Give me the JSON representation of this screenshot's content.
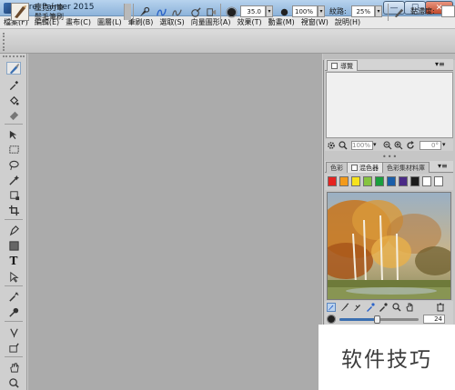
{
  "window": {
    "title": "Corel Painter 2015",
    "min_glyph": "—",
    "max_glyph": "☐",
    "close_glyph": "✕"
  },
  "menu": [
    "檔案(F)",
    "編輯(E)",
    "畫布(C)",
    "圖層(L)",
    "筆刷(B)",
    "選取(S)",
    "向量圖形(A)",
    "效果(T)",
    "動畫(M)",
    "視窗(W)",
    "說明(H)"
  ],
  "property_bar": {
    "brush_category": "壓克力筆",
    "brush_variant": "鬃毛筆刷",
    "size_value": "35.0",
    "opacity_value": "100%",
    "grain_label": "紋路:",
    "grain_value": "25%",
    "viscosity_label": "黏滯度:"
  },
  "navigator": {
    "tab_label": "導覽",
    "zoom_value": "100%",
    "rotate_value": "0°"
  },
  "color_panel": {
    "tabs": [
      "色彩",
      "混色器",
      "色彩集材料庫"
    ],
    "swatches": [
      "#e52421",
      "#f39a1b",
      "#f6e21c",
      "#86c440",
      "#1a9e3e",
      "#1b5fa9",
      "#4a2a86",
      "#1c1c1c",
      "#ffffff",
      "#ffffff"
    ],
    "brush_size_value": "24"
  },
  "watermark": "软件技巧",
  "colors": {
    "titlebar": "#a3c4e6",
    "canvas_bg": "#ababab",
    "panel_bg": "#c6c6c6",
    "close_button": "#c24a2c"
  }
}
